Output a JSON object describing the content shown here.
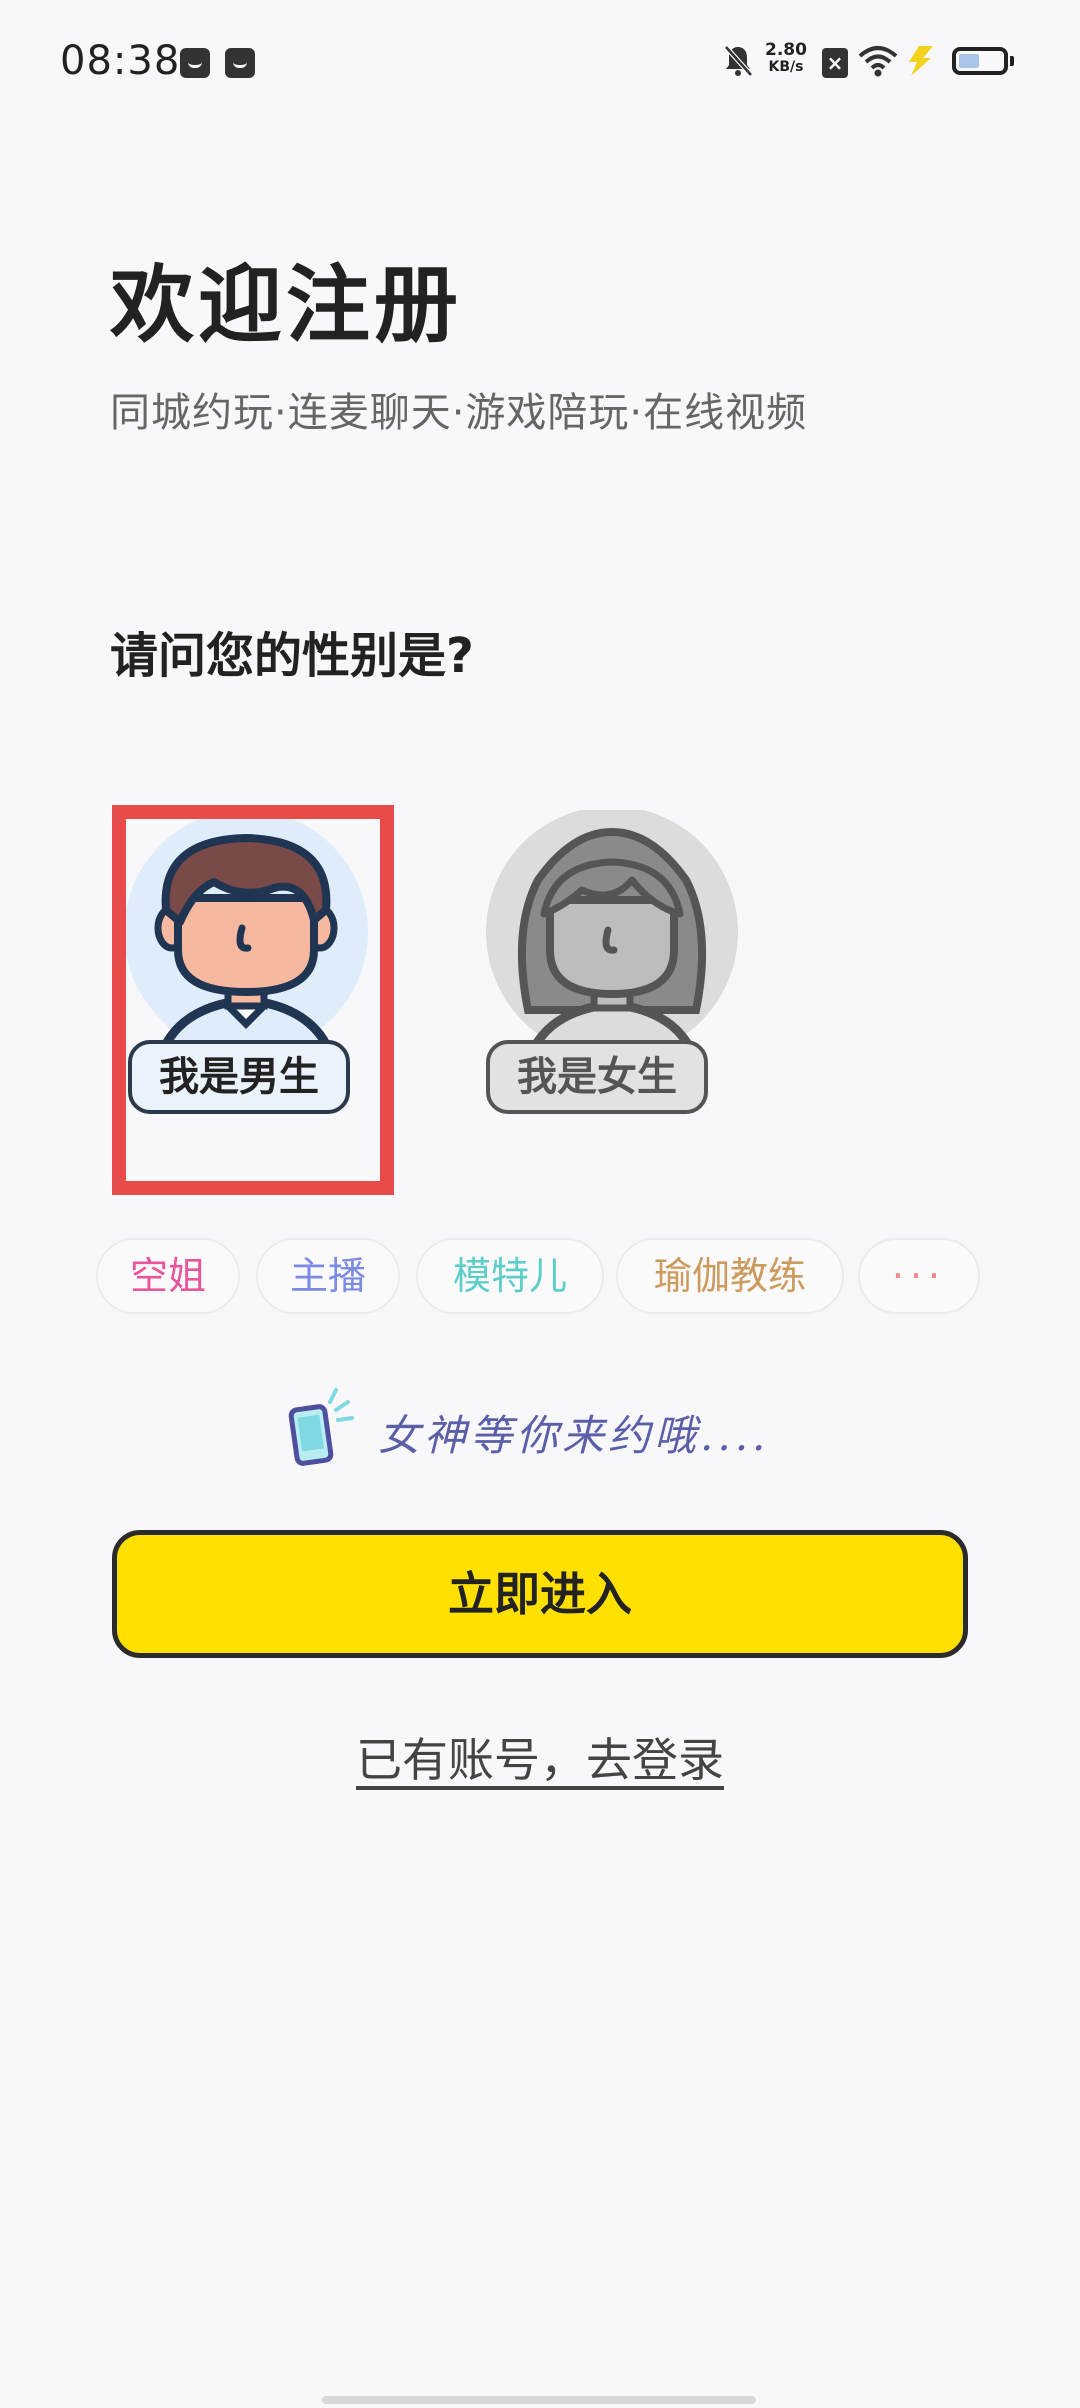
{
  "status_bar": {
    "time": "08:38",
    "net_speed_value": "2.80",
    "net_speed_unit": "KB/s",
    "sim_label": "×",
    "icons": [
      "inbox-icon",
      "bag-icon",
      "mute-icon",
      "sim-icon",
      "wifi-icon",
      "bolt-icon",
      "battery-icon"
    ]
  },
  "header": {
    "title": "欢迎注册",
    "subtitle": "同城约玩·连麦聊天·游戏陪玩·在线视频"
  },
  "gender": {
    "question": "请问您的性别是?",
    "options": [
      {
        "label": "我是男生",
        "selected": true
      },
      {
        "label": "我是女生",
        "selected": false
      }
    ]
  },
  "tags": [
    {
      "label": "空姐",
      "color": "#E8559A"
    },
    {
      "label": "主播",
      "color": "#7C8BE3"
    },
    {
      "label": "模特儿",
      "color": "#5ECEC8"
    },
    {
      "label": "瑜伽教练",
      "color": "#CC9B5E"
    },
    {
      "label": "···",
      "color": "#F08A8A"
    }
  ],
  "slogan": {
    "text": "女神等你来约哦....",
    "icon": "phone-icon"
  },
  "actions": {
    "enter_label": "立即进入",
    "login_label": "已有账号，去登录"
  },
  "colors": {
    "accent": "#FFE000",
    "selection_frame": "#E84C4A",
    "background": "#F8F8FA"
  }
}
